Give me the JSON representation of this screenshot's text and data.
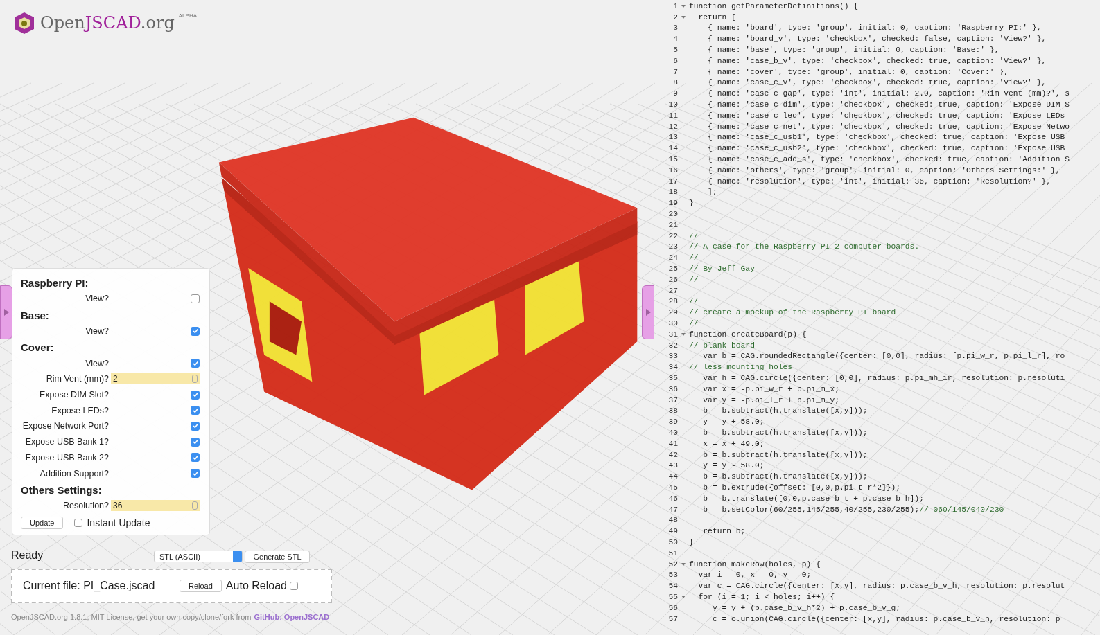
{
  "logo": {
    "name_start": "Open",
    "name_accent": "JSCAD",
    "name_end": ".org",
    "badge": "ALPHA"
  },
  "parameters": [
    {
      "kind": "group",
      "caption": "Raspberry PI:"
    },
    {
      "kind": "checkbox",
      "caption": "View?",
      "checked": false
    },
    {
      "kind": "group",
      "caption": "Base:"
    },
    {
      "kind": "checkbox",
      "caption": "View?",
      "checked": true
    },
    {
      "kind": "group",
      "caption": "Cover:"
    },
    {
      "kind": "checkbox",
      "caption": "View?",
      "checked": true
    },
    {
      "kind": "int",
      "caption": "Rim Vent (mm)?",
      "value": "2"
    },
    {
      "kind": "checkbox",
      "caption": "Expose DIM Slot?",
      "checked": true
    },
    {
      "kind": "checkbox",
      "caption": "Expose LEDs?",
      "checked": true
    },
    {
      "kind": "checkbox",
      "caption": "Expose Network Port?",
      "checked": true
    },
    {
      "kind": "checkbox",
      "caption": "Expose USB Bank 1?",
      "checked": true
    },
    {
      "kind": "checkbox",
      "caption": "Expose USB Bank 2?",
      "checked": true
    },
    {
      "kind": "checkbox",
      "caption": "Addition Support?",
      "checked": true
    },
    {
      "kind": "group",
      "caption": "Others Settings:"
    },
    {
      "kind": "int",
      "caption": "Resolution?",
      "value": "36"
    }
  ],
  "update_button": "Update",
  "instant_update": {
    "label": "Instant Update",
    "checked": false
  },
  "status": "Ready",
  "format_select": {
    "value": "STL (ASCII)"
  },
  "generate_button": "Generate STL",
  "file_panel": {
    "label": "Current file: PI_Case.jscad",
    "reload_button": "Reload",
    "auto_reload": {
      "label": "Auto Reload",
      "checked": false
    }
  },
  "footer": {
    "text": "OpenJSCAD.org 1.8.1, MIT License, get your own copy/clone/fork from",
    "link": "GitHub: OpenJSCAD"
  },
  "editor": {
    "lines": [
      {
        "number": "1",
        "code": "function getParameterDefinitions() {",
        "foldable": true
      },
      {
        "number": "2",
        "code": "  return [",
        "foldable": true
      },
      {
        "number": "3",
        "code": "    { name: 'board', type: 'group', initial: 0, caption: 'Raspberry PI:' },"
      },
      {
        "number": "4",
        "code": "    { name: 'board_v', type: 'checkbox', checked: false, caption: 'View?' },"
      },
      {
        "number": "5",
        "code": "    { name: 'base', type: 'group', initial: 0, caption: 'Base:' },"
      },
      {
        "number": "6",
        "code": "    { name: 'case_b_v', type: 'checkbox', checked: true, caption: 'View?' },"
      },
      {
        "number": "7",
        "code": "    { name: 'cover', type: 'group', initial: 0, caption: 'Cover:' },"
      },
      {
        "number": "8",
        "code": "    { name: 'case_c_v', type: 'checkbox', checked: true, caption: 'View?' },"
      },
      {
        "number": "9",
        "code": "    { name: 'case_c_gap', type: 'int', initial: 2.0, caption: 'Rim Vent (mm)?', s"
      },
      {
        "number": "10",
        "code": "    { name: 'case_c_dim', type: 'checkbox', checked: true, caption: 'Expose DIM S"
      },
      {
        "number": "11",
        "code": "    { name: 'case_c_led', type: 'checkbox', checked: true, caption: 'Expose LEDs"
      },
      {
        "number": "12",
        "code": "    { name: 'case_c_net', type: 'checkbox', checked: true, caption: 'Expose Netwo"
      },
      {
        "number": "13",
        "code": "    { name: 'case_c_usb1', type: 'checkbox', checked: true, caption: 'Expose USB"
      },
      {
        "number": "14",
        "code": "    { name: 'case_c_usb2', type: 'checkbox', checked: true, caption: 'Expose USB"
      },
      {
        "number": "15",
        "code": "    { name: 'case_c_add_s', type: 'checkbox', checked: true, caption: 'Addition S"
      },
      {
        "number": "16",
        "code": "    { name: 'others', type: 'group', initial: 0, caption: 'Others Settings:' },"
      },
      {
        "number": "17",
        "code": "    { name: 'resolution', type: 'int', initial: 36, caption: 'Resolution?' },"
      },
      {
        "number": "18",
        "code": "    ];"
      },
      {
        "number": "19",
        "code": "}"
      },
      {
        "number": "20"
      },
      {
        "number": "21"
      },
      {
        "number": "22",
        "comment": "//"
      },
      {
        "number": "23",
        "comment": "// A case for the Raspberry PI 2 computer boards."
      },
      {
        "number": "24",
        "comment": "//"
      },
      {
        "number": "25",
        "comment": "// By Jeff Gay"
      },
      {
        "number": "26",
        "comment": "//"
      },
      {
        "number": "27"
      },
      {
        "number": "28",
        "comment": "//"
      },
      {
        "number": "29",
        "comment": "// create a mockup of the Raspberry PI board"
      },
      {
        "number": "30",
        "comment": "//"
      },
      {
        "number": "31",
        "code": "function createBoard(p) {",
        "foldable": true
      },
      {
        "number": "32",
        "comment": "// blank board"
      },
      {
        "number": "33",
        "code": "   var b = CAG.roundedRectangle({center: [0,0], radius: [p.pi_w_r, p.pi_l_r], ro"
      },
      {
        "number": "34",
        "comment": "// less mounting holes"
      },
      {
        "number": "35",
        "code": "   var h = CAG.circle({center: [0,0], radius: p.pi_mh_ir, resolution: p.resoluti"
      },
      {
        "number": "36",
        "code": "   var x = -p.pi_w_r + p.pi_m_x;"
      },
      {
        "number": "37",
        "code": "   var y = -p.pi_l_r + p.pi_m_y;"
      },
      {
        "number": "38",
        "code": "   b = b.subtract(h.translate([x,y]));"
      },
      {
        "number": "39",
        "code": "   y = y + 58.0;"
      },
      {
        "number": "40",
        "code": "   b = b.subtract(h.translate([x,y]));"
      },
      {
        "number": "41",
        "code": "   x = x + 49.0;"
      },
      {
        "number": "42",
        "code": "   b = b.subtract(h.translate([x,y]));"
      },
      {
        "number": "43",
        "code": "   y = y - 58.0;"
      },
      {
        "number": "44",
        "code": "   b = b.subtract(h.translate([x,y]));"
      },
      {
        "number": "45",
        "code": "   b = b.extrude({offset: [0,0,p.pi_t_r*2]});"
      },
      {
        "number": "46",
        "code": "   b = b.translate([0,0,p.case_b_t + p.case_b_h]);"
      },
      {
        "number": "47",
        "code": "   b = b.setColor(60/255,145/255,40/255,230/255);",
        "comment": "// 060/145/040/230"
      },
      {
        "number": "48"
      },
      {
        "number": "49",
        "code": "   return b;"
      },
      {
        "number": "50",
        "code": "}"
      },
      {
        "number": "51"
      },
      {
        "number": "52",
        "code": "function makeRow(holes, p) {",
        "foldable": true
      },
      {
        "number": "53",
        "code": "  var i = 0, x = 0, y = 0;"
      },
      {
        "number": "54",
        "code": "  var c = CAG.circle({center: [x,y], radius: p.case_b_v_h, resolution: p.resolut"
      },
      {
        "number": "55",
        "code": "  for (i = 1; i < holes; i++) {",
        "foldable": true
      },
      {
        "number": "56",
        "code": "     y = y + (p.case_b_v_h*2) + p.case_b_v_g;"
      },
      {
        "number": "57",
        "code": "     c = c.union(CAG.circle({center: [x,y], radius: p.case_b_v_h, resolution: p"
      }
    ]
  }
}
